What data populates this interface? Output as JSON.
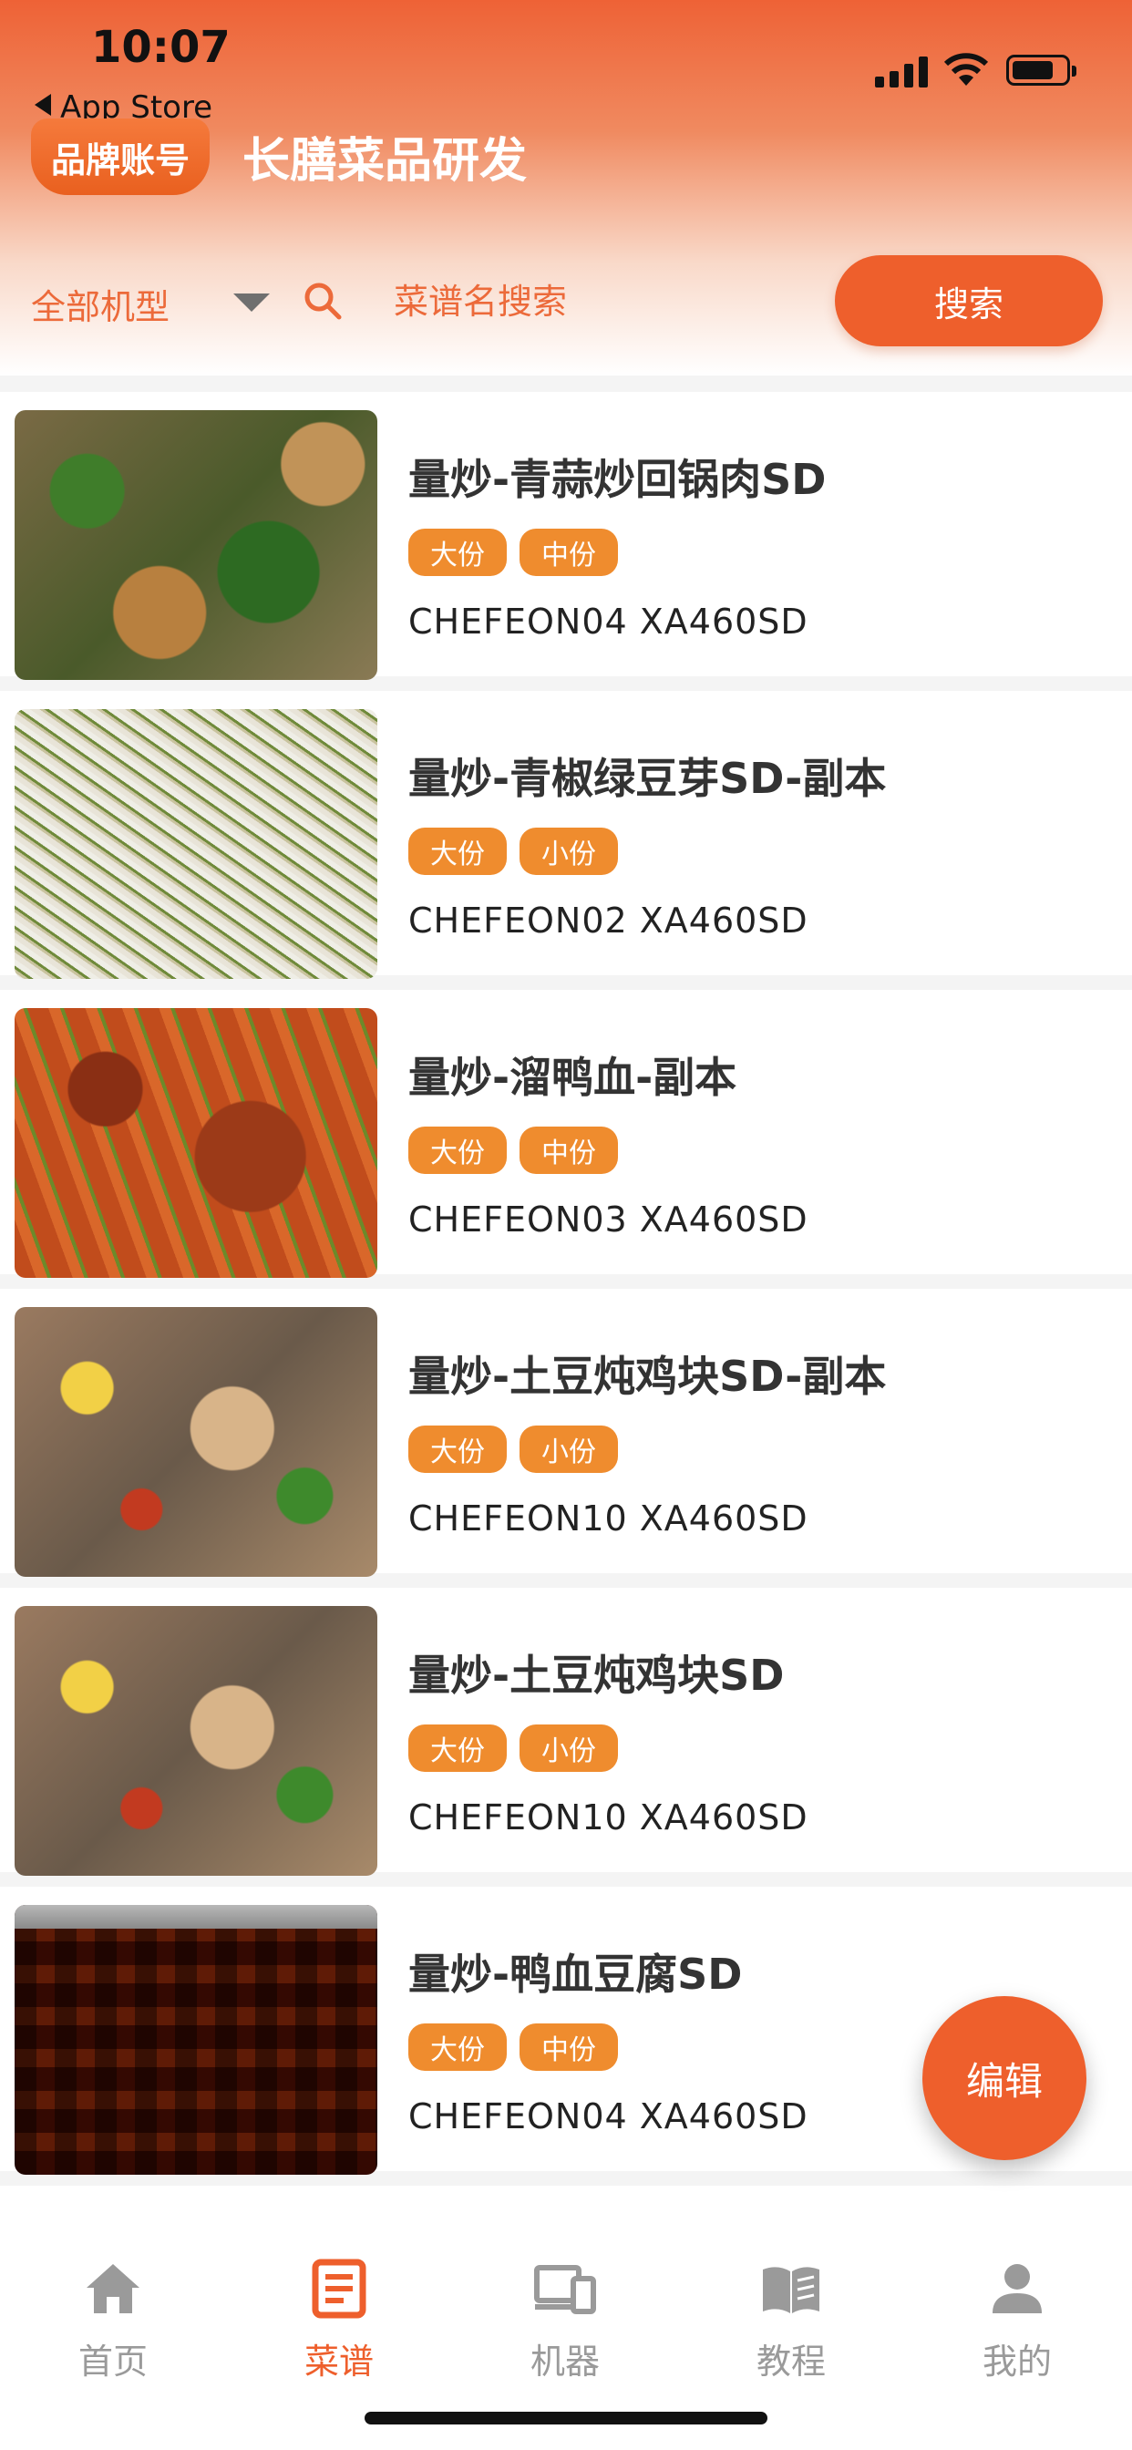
{
  "status_bar": {
    "time": "10:07",
    "back_label": "App Store"
  },
  "header": {
    "brand_button": "品牌账号",
    "title": "长膳菜品研发",
    "model_filter": "全部机型",
    "search_placeholder": "菜谱名搜索",
    "search_button": "搜索"
  },
  "recipes": [
    {
      "name": "量炒-青蒜炒回锅肉SD",
      "tags": [
        "大份",
        "中份"
      ],
      "models": "CHEFEON04 XA460SD"
    },
    {
      "name": "量炒-青椒绿豆芽SD-副本",
      "tags": [
        "大份",
        "小份"
      ],
      "models": "CHEFEON02 XA460SD"
    },
    {
      "name": "量炒-溜鸭血-副本",
      "tags": [
        "大份",
        "中份"
      ],
      "models": "CHEFEON03 XA460SD"
    },
    {
      "name": "量炒-土豆炖鸡块SD-副本",
      "tags": [
        "大份",
        "小份"
      ],
      "models": "CHEFEON10 XA460SD"
    },
    {
      "name": "量炒-土豆炖鸡块SD",
      "tags": [
        "大份",
        "小份"
      ],
      "models": "CHEFEON10 XA460SD"
    },
    {
      "name": "量炒-鸭血豆腐SD",
      "tags": [
        "大份",
        "中份"
      ],
      "models": "CHEFEON04 XA460SD"
    }
  ],
  "edit_button": "编辑",
  "tabs": [
    {
      "label": "首页",
      "icon": "home-icon"
    },
    {
      "label": "菜谱",
      "icon": "recipe-icon",
      "active": true
    },
    {
      "label": "机器",
      "icon": "device-icon"
    },
    {
      "label": "教程",
      "icon": "book-icon"
    },
    {
      "label": "我的",
      "icon": "user-icon"
    }
  ],
  "colors": {
    "accent": "#ee5f2c",
    "tag": "#ef8c2e",
    "inactive": "#9a9a9a"
  }
}
